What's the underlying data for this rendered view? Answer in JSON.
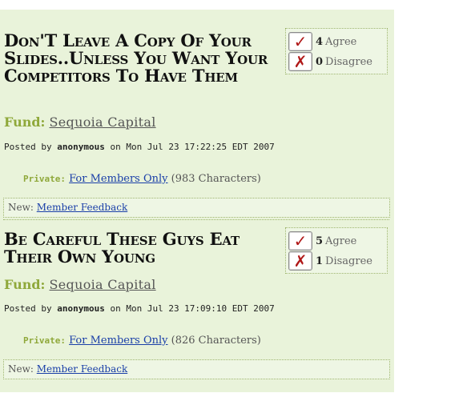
{
  "posts": [
    {
      "title": "Don'T Leave A Copy Of Your Slides..Unless You Want Your Competitors To Have Them",
      "agree_count": "4",
      "agree_label": "Agree",
      "disagree_count": "0",
      "disagree_label": "Disagree",
      "fund_label": "Fund:",
      "fund_name": "Sequoia Capital",
      "posted_prefix": "Posted by",
      "author": "anonymous",
      "posted_on": "on Mon Jul 23 17:22:25 EDT 2007",
      "private_label": "Private:",
      "private_link": "For Members Only",
      "private_chars": "(983 Characters)",
      "new_label": "New:",
      "new_link": "Member Feedback"
    },
    {
      "title": "Be Careful These Guys Eat Their Own Young",
      "agree_count": "5",
      "agree_label": "Agree",
      "disagree_count": "1",
      "disagree_label": "Disagree",
      "fund_label": "Fund:",
      "fund_name": "Sequoia Capital",
      "posted_prefix": "Posted by",
      "author": "anonymous",
      "posted_on": "on Mon Jul 23 17:09:10 EDT 2007",
      "private_label": "Private:",
      "private_link": "For Members Only",
      "private_chars": "(826 Characters)",
      "new_label": "New:",
      "new_link": "Member Feedback"
    }
  ],
  "icons": {
    "agree": "checkmark-icon",
    "disagree": "x-mark-icon"
  },
  "colors": {
    "panel_bg": "#e9f3da",
    "accent_green": "#8fa83a",
    "vote_mark_red": "#b01818",
    "link_blue": "#1a3fa8"
  }
}
